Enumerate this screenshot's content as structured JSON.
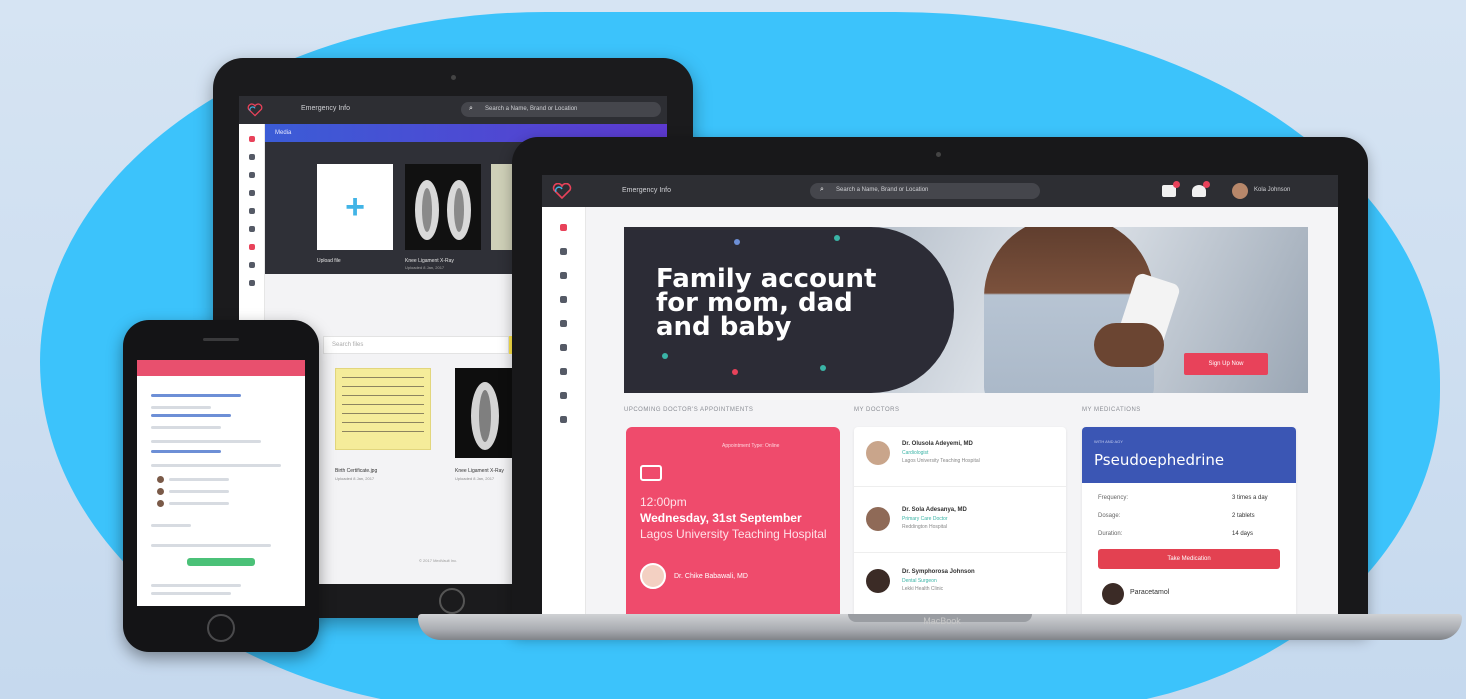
{
  "colors": {
    "background": "#3cc3fb",
    "accent_pink": "#ef4b6c",
    "accent_red": "#e8425a",
    "med_blue": "#3b56b4",
    "topbar": "#2d2e33",
    "upload_plus": "#42b4e6",
    "search_button": "#ffe74a"
  },
  "tablet": {
    "app_title": "Emergency Info",
    "search_placeholder": "Search a Name, Brand or Location",
    "section_band": "Media",
    "upload_label": "Upload file",
    "upload_icon": "plus-icon",
    "xray_title": "Knee Ligament X-Ray",
    "xray_sub": "Uploaded 8 Jan, 2017",
    "file_search_placeholder": "Search files",
    "search_icon": "search-icon",
    "note_title": "Birth Certificate.jpg",
    "note_sub": "Uploaded 8 Jan, 2017",
    "xray2_title": "Knee Ligament X-Ray",
    "xray2_sub": "Uploaded 8 Jan, 2017",
    "footer": "© 2017 MedVault Inc."
  },
  "laptop": {
    "app_title": "Emergency Info",
    "search_placeholder": "Search a Name, Brand or Location",
    "user_name": "Kola Johnson",
    "brand": "MacBook",
    "hero": {
      "headline": "Family account for mom, dad and baby",
      "button": "Sign Up Now"
    },
    "sections": {
      "appointments": "UPCOMING DOCTOR'S APPOINTMENTS",
      "doctors": "MY DOCTORS",
      "medications": "MY MEDICATIONS"
    },
    "appointment": {
      "label": "Appointment Type: Online",
      "time": "12:00pm",
      "date": "Wednesday, 31st September",
      "place": "Lagos University Teaching Hospital",
      "doctor": "Dr. Chike Babawali, MD"
    },
    "doctors": [
      {
        "name": "Dr. Olusola Adeyemi, MD",
        "role": "Cardiologist",
        "hospital": "Lagos University Teaching Hospital"
      },
      {
        "name": "Dr. Sola Adesanya, MD",
        "role": "Primary Care Doctor",
        "hospital": "Reddington Hospital"
      },
      {
        "name": "Dr. Symphorosa Johnson",
        "role": "Dental Surgeon",
        "hospital": "Lekki Health Clinic"
      }
    ],
    "medication": {
      "tag": "WITH AND AGY",
      "name": "Pseudoephedrine",
      "rows": [
        {
          "k": "Frequency:",
          "v": "3 times a day"
        },
        {
          "k": "Dosage:",
          "v": "2 tablets"
        },
        {
          "k": "Duration:",
          "v": "14 days"
        }
      ],
      "button": "Take Medication",
      "next_name": "Paracetamol"
    }
  }
}
